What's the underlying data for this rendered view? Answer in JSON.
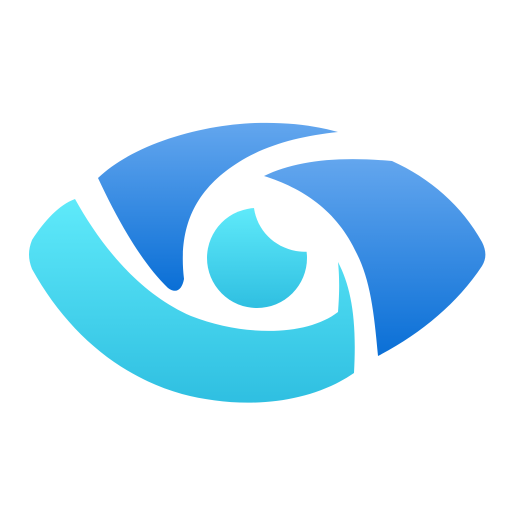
{
  "image": {
    "icon_name": "eye-icon",
    "background_color": "#FFFFFF",
    "colors": {
      "deep_blue": "#0A6FD6",
      "mid_blue": "#2E86E3",
      "light_blue": "#63A6EE",
      "cyan_light": "#5FEAFA",
      "cyan_mid": "#42D7EE",
      "cyan_dark": "#2FBFE1"
    }
  }
}
